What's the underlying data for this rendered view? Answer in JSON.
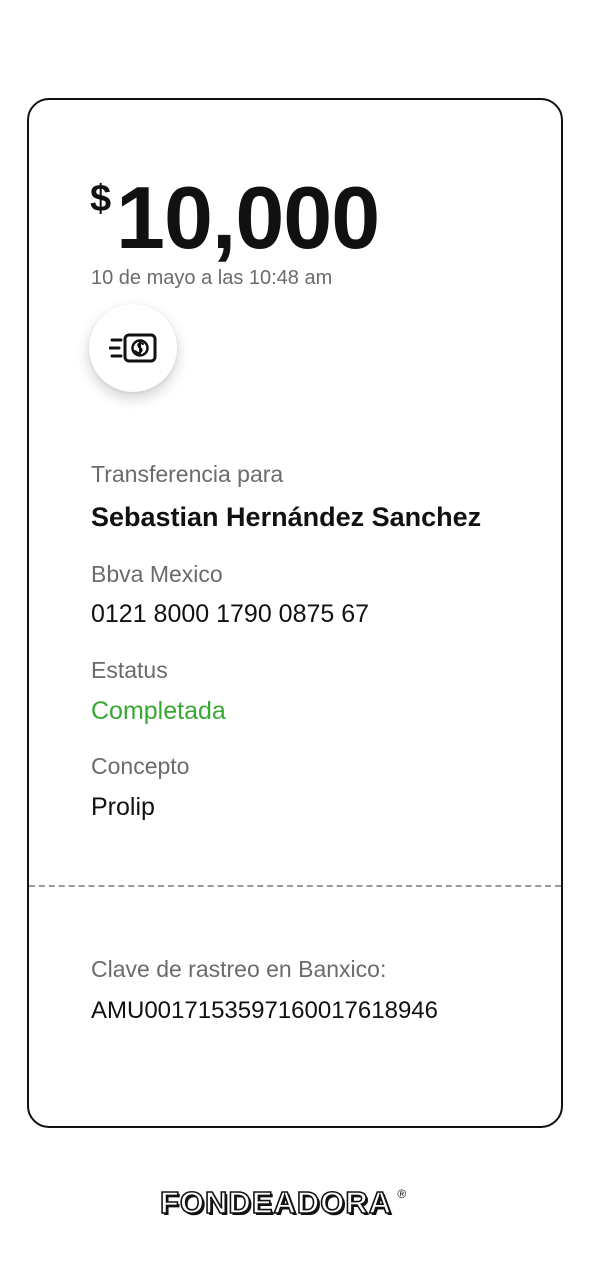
{
  "receipt": {
    "currency_symbol": "$",
    "amount": "10,000",
    "date": "10 de mayo a las 10:48 am",
    "transfer_icon": "cash-transfer-icon",
    "recipient_label": "Transferencia para",
    "recipient_name": "Sebastian Hernández Sanchez",
    "bank_label": "Bbva Mexico",
    "account_number": "0121 8000 1790 0875 67",
    "status_label": "Estatus",
    "status_value": "Completada",
    "status_color": "#37a832",
    "concept_label": "Concepto",
    "concept_value": "Prolip",
    "trace_label": "Clave de rastreo en Banxico:",
    "trace_value": "AMU0017153597160017618946"
  },
  "footer": {
    "brand": "FONDEADORA",
    "brand_mark": "®"
  }
}
